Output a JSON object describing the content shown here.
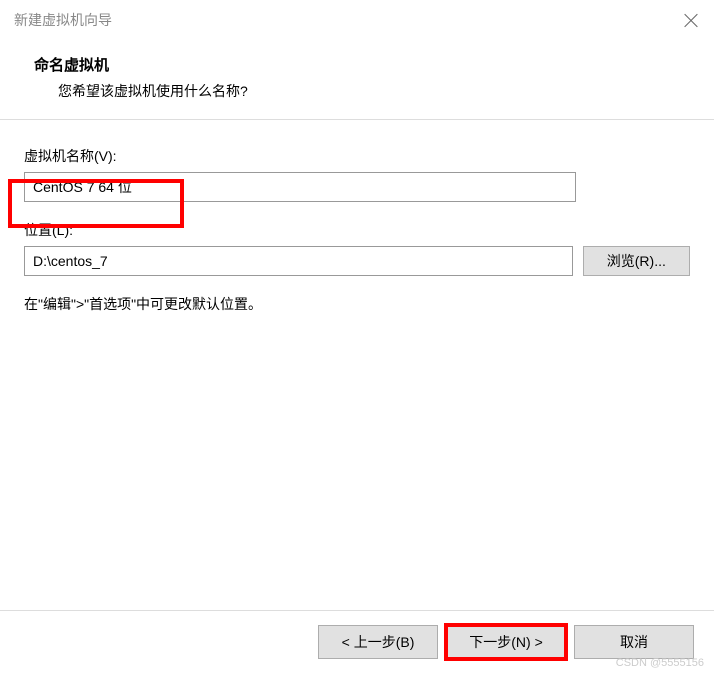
{
  "title": "新建虚拟机向导",
  "header": {
    "title": "命名虚拟机",
    "desc": "您希望该虚拟机使用什么名称?"
  },
  "fields": {
    "name_label": "虚拟机名称(V):",
    "name_value": "CentOS 7 64 位",
    "location_label": "位置(L):",
    "location_value": "D:\\centos_7",
    "browse_label": "浏览(R)...",
    "hint": "在\"编辑\">\"首选项\"中可更改默认位置。"
  },
  "buttons": {
    "back": "< 上一步(B)",
    "next": "下一步(N) >",
    "cancel": "取消"
  },
  "watermark": "CSDN @5555156"
}
